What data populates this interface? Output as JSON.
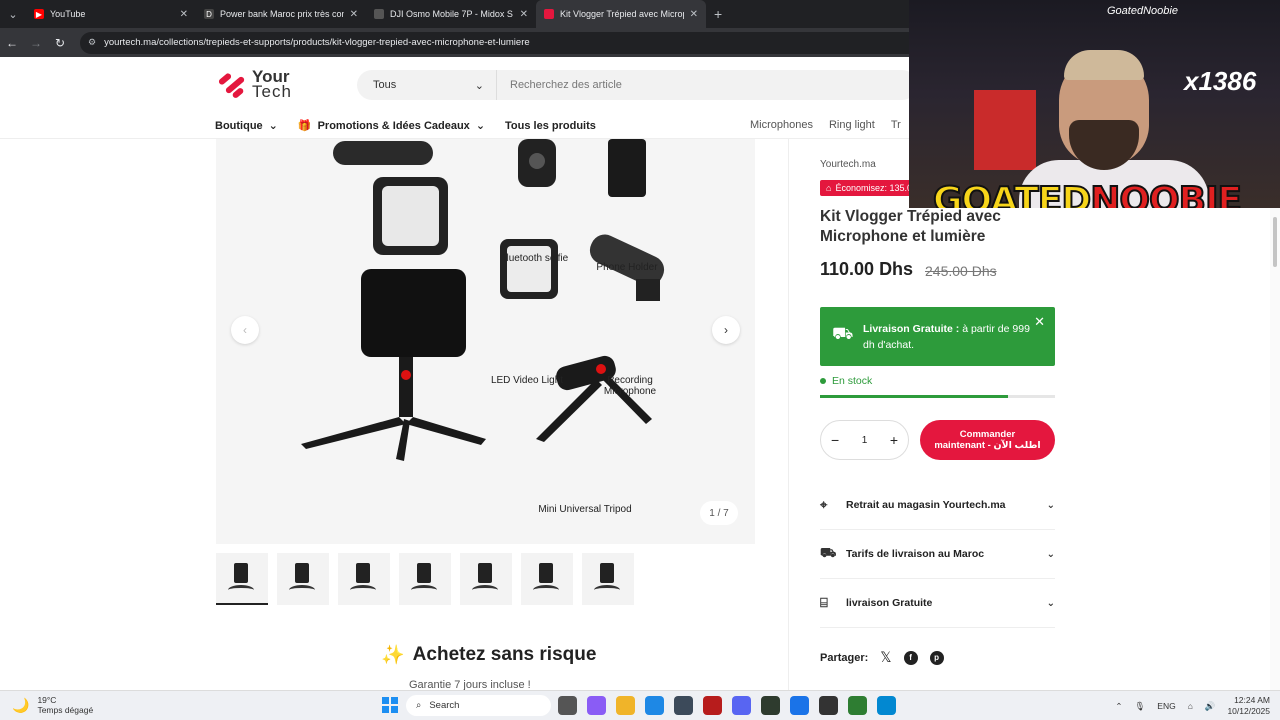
{
  "browser": {
    "tabs": [
      {
        "title": "YouTube",
        "fav_color": "#ff0000",
        "active": false
      },
      {
        "title": "Power bank Maroc prix très comp",
        "fav_color": "#444444",
        "active": false
      },
      {
        "title": "DJI Osmo Mobile 7P - Midox S",
        "fav_color": "#555555",
        "active": false
      },
      {
        "title": "Kit Vlogger Trépied avec Microp",
        "fav_color": "#e4173e",
        "active": true
      }
    ],
    "url": "yourtech.ma/collections/trepieds-et-supports/products/kit-vlogger-trepied-avec-microphone-et-lumiere"
  },
  "header": {
    "logo_line1": "Your",
    "logo_line2": "Tech",
    "search_category": "Tous",
    "search_placeholder": "Recherchez des article",
    "nav": [
      {
        "label": "Boutique",
        "dropdown": true
      },
      {
        "label": "Promotions & Idées Cadeaux",
        "dropdown": true
      },
      {
        "label": "Tous les produits",
        "dropdown": false
      }
    ],
    "subnav": [
      "Microphones",
      "Ring light",
      "Tr"
    ]
  },
  "gallery": {
    "captions": {
      "selfie": "Bluetooth selfie",
      "holder": "Phone Holder",
      "led": "LED Video Light",
      "mic": "Recording Microphone",
      "tripod": "Mini Universal Tripod"
    },
    "counter": "1 / 7",
    "thumb_count": 7
  },
  "product": {
    "vendor": "Yourtech.ma",
    "save_badge": "Économisez: 135.0",
    "title": "Kit Vlogger Trépied avec Microphone et lumière",
    "price": "110.00 Dhs",
    "old_price": "245.00 Dhs",
    "shipping_bold": "Livraison Gratuite :",
    "shipping_text": " à partir de 999 dh d'achat.",
    "stock": "En stock",
    "stock_level": 0.8,
    "quantity": "1",
    "order_line1": "Commander",
    "order_line2": "maintenant - اطلب الآن",
    "accordions": [
      {
        "label": "Retrait au magasin Yourtech.ma",
        "icon": "location-pin-icon"
      },
      {
        "label": "Tarifs de livraison au Maroc",
        "icon": "truck-icon"
      },
      {
        "label": "livraison Gratuite",
        "icon": "gift-icon"
      }
    ],
    "share_label": "Partager:"
  },
  "risk": {
    "title": "Achetez sans risque",
    "subtitle": "Garantie 7 jours incluse !"
  },
  "overlay": {
    "tag": "GoatedNoobie",
    "count": "x1386",
    "brand_a": "GOATED",
    "brand_b": "NOOBIE"
  },
  "taskbar": {
    "temp": "19°C",
    "weather": "Temps dégagé",
    "search": "Search",
    "lang": "ENG",
    "time": "12:24 AM",
    "date": "10/12/2025"
  }
}
